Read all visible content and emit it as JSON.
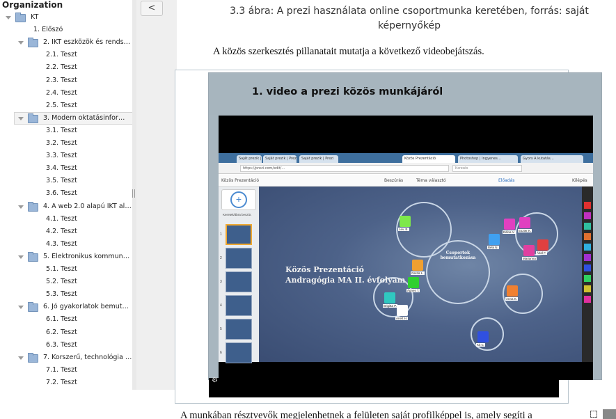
{
  "sidebar": {
    "header": "Organization",
    "items": [
      {
        "label": "KT",
        "level": 0,
        "folder": true,
        "expanded": true
      },
      {
        "label": "1. Előszó",
        "level": 1,
        "folder": false
      },
      {
        "label": "2. IKT eszközök és rends…",
        "level": 1,
        "folder": true,
        "expanded": true
      },
      {
        "label": "2.1. Teszt",
        "level": 2,
        "folder": false
      },
      {
        "label": "2.2. Teszt",
        "level": 2,
        "folder": false
      },
      {
        "label": "2.3. Teszt",
        "level": 2,
        "folder": false
      },
      {
        "label": "2.4. Teszt",
        "level": 2,
        "folder": false
      },
      {
        "label": "2.5. Teszt",
        "level": 2,
        "folder": false
      },
      {
        "label": "3. Modern oktatásinfor…",
        "level": 1,
        "folder": true,
        "expanded": true,
        "selected": true
      },
      {
        "label": "3.1. Teszt",
        "level": 2,
        "folder": false
      },
      {
        "label": "3.2. Teszt",
        "level": 2,
        "folder": false
      },
      {
        "label": "3.3. Teszt",
        "level": 2,
        "folder": false
      },
      {
        "label": "3.4. Teszt",
        "level": 2,
        "folder": false
      },
      {
        "label": "3.5. Teszt",
        "level": 2,
        "folder": false
      },
      {
        "label": "3.6. Teszt",
        "level": 2,
        "folder": false
      },
      {
        "label": "4. A web 2.0 alapú IKT al…",
        "level": 1,
        "folder": true,
        "expanded": true
      },
      {
        "label": "4.1. Teszt",
        "level": 2,
        "folder": false
      },
      {
        "label": "4.2. Teszt",
        "level": 2,
        "folder": false
      },
      {
        "label": "4.3. Teszt",
        "level": 2,
        "folder": false
      },
      {
        "label": "5. Elektronikus kommun…",
        "level": 1,
        "folder": true,
        "expanded": true
      },
      {
        "label": "5.1. Teszt",
        "level": 2,
        "folder": false
      },
      {
        "label": "5.2. Teszt",
        "level": 2,
        "folder": false
      },
      {
        "label": "5.3. Teszt",
        "level": 2,
        "folder": false
      },
      {
        "label": "6. Jó gyakorlatok bemut…",
        "level": 1,
        "folder": true,
        "expanded": true
      },
      {
        "label": "6.1. Teszt",
        "level": 2,
        "folder": false
      },
      {
        "label": "6.2. Teszt",
        "level": 2,
        "folder": false
      },
      {
        "label": "6.3. Teszt",
        "level": 2,
        "folder": false
      },
      {
        "label": "7. Korszerű, technológia …",
        "level": 1,
        "folder": true,
        "expanded": true
      },
      {
        "label": "7.1. Teszt",
        "level": 2,
        "folder": false
      },
      {
        "label": "7.2. Teszt",
        "level": 2,
        "folder": false
      }
    ]
  },
  "collapse_button": {
    "label": "<"
  },
  "content": {
    "figure_caption_line1": "3.3 ábra: A prezi használata online csoportmunka keretében, forrás: saját",
    "figure_caption_line2": "képernyőkép",
    "intro_text": "A közös szerkesztés pillanatait mutatja a következő videobejátszás.",
    "video_title": "1. video a prezi közös munkájáról",
    "bottom_text": "A munkában résztvevők megjelenhetnek a felületen saját profilképpel is, amely segíti a"
  },
  "video_screen": {
    "tabs": [
      "Saját prezik | Prezi",
      "Saját prezik | Prezi",
      "Saját prezik | Prezi",
      "Közös Prezentáció",
      "Photoshop | Ingyenes…",
      "Gyors A kutatás…"
    ],
    "url": "https://prezi.com/edit/…",
    "search_placeholder": "Keresés",
    "toolbar_title": "Közös Prezentáció",
    "toolbar_insert": "Beszúrás",
    "toolbar_theme": "Téma választó",
    "toolbar_present": "Előadás",
    "toolbar_exit": "Kilépés",
    "canvas_title_line1": "Közös Prezentáció",
    "canvas_title_line2": "Andragógia MA II. évfolyam",
    "center_circle_label": "Csoportok bemutatkozása",
    "add_label": "Keretek/ábra beszúr.",
    "avatar_labels": [
      "Lev. B.",
      "Gerda L.",
      "Ágnes T.",
      "Brigitta P.",
      "Anett H.",
      "Edina V.",
      "Béla N.",
      "Marianna",
      "Ábel F.",
      "Anna K.",
      "Kit C.",
      "Eszter K."
    ],
    "thumb_numbers": [
      "1",
      "2",
      "3",
      "4",
      "5",
      "6"
    ],
    "colors": {
      "canvas": "#4d6289",
      "tabbar": "#3e6f9e",
      "swatches": [
        "#e03030",
        "#c030c0",
        "#30c0a0",
        "#e07030",
        "#30b0e0",
        "#a030d0",
        "#3050e0",
        "#30d060",
        "#d0c030",
        "#e030a0"
      ]
    }
  }
}
